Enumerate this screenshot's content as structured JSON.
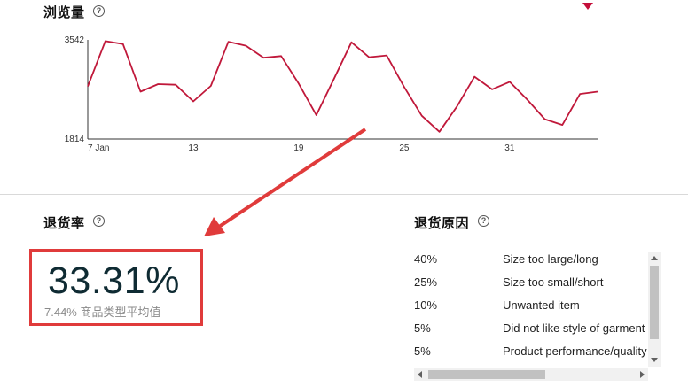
{
  "pageviews": {
    "title": "浏览量",
    "help_icon": "question-circle-icon",
    "marker_icon": "triangle-down-icon",
    "marker_color": "#c40f3a"
  },
  "chart_data": {
    "type": "line",
    "title": "",
    "xlabel": "",
    "ylabel": "",
    "ylim": [
      1814,
      3542
    ],
    "y_ticks": [
      "3542",
      "1814"
    ],
    "x_ticks": [
      {
        "day": 1,
        "label": "7 Jan"
      },
      {
        "day": 7,
        "label": "13"
      },
      {
        "day": 13,
        "label": "19"
      },
      {
        "day": 19,
        "label": "25"
      },
      {
        "day": 25,
        "label": "31"
      }
    ],
    "x_start": "7 Jan",
    "line_color": "#c0183a",
    "x": [
      1,
      2,
      3,
      4,
      5,
      6,
      7,
      8,
      9,
      10,
      11,
      12,
      13,
      14,
      15,
      16,
      17,
      18,
      19,
      20,
      21,
      22,
      23,
      24,
      25,
      26,
      27,
      28,
      29,
      30
    ],
    "values": [
      2730,
      3520,
      3470,
      2640,
      2770,
      2760,
      2470,
      2740,
      3510,
      3440,
      3230,
      3260,
      2780,
      2230,
      2860,
      3500,
      3240,
      3270,
      2720,
      2220,
      1940,
      2380,
      2900,
      2680,
      2810,
      2500,
      2160,
      2060,
      2600,
      2640
    ]
  },
  "return_rate": {
    "title": "退货率",
    "help_icon": "question-circle-icon",
    "value": "33.31%",
    "benchmark": "7.44% 商品类型平均值",
    "highlight_color": "#e03b3b"
  },
  "return_reasons": {
    "title": "退货原因",
    "help_icon": "question-circle-icon",
    "rows": [
      {
        "pct": "40%",
        "reason": "Size too large/long"
      },
      {
        "pct": "25%",
        "reason": "Size too small/short"
      },
      {
        "pct": "10%",
        "reason": "Unwanted item"
      },
      {
        "pct": "5%",
        "reason": "Did not like style of garment"
      },
      {
        "pct": "5%",
        "reason": "Product performance/quality"
      }
    ]
  }
}
